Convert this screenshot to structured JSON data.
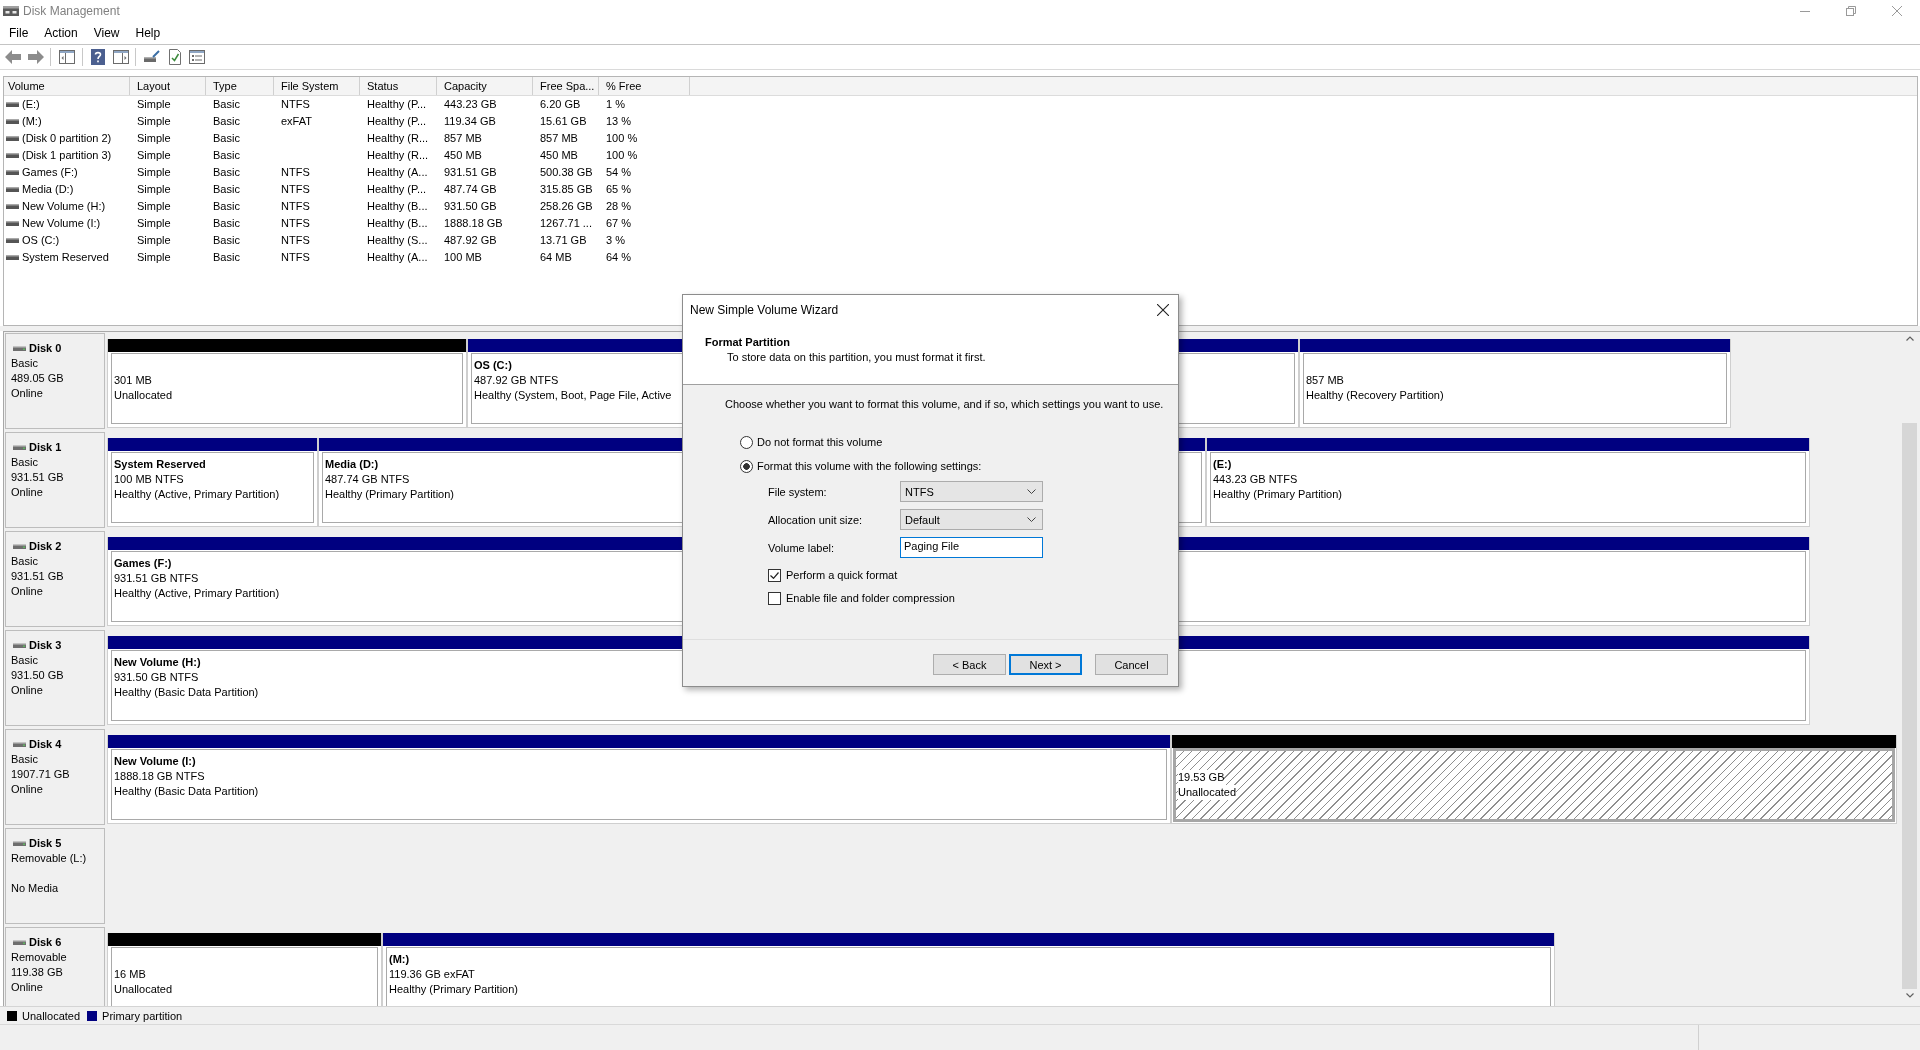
{
  "window": {
    "title": "Disk Management"
  },
  "menu": [
    "File",
    "Action",
    "View",
    "Help"
  ],
  "volume_list": {
    "columns": [
      "Volume",
      "Layout",
      "Type",
      "File System",
      "Status",
      "Capacity",
      "Free Spa...",
      "% Free"
    ],
    "rows": [
      {
        "volume": "(E:)",
        "layout": "Simple",
        "type": "Basic",
        "file_system": "NTFS",
        "status": "Healthy (P...",
        "capacity": "443.23 GB",
        "free_space": "6.20 GB",
        "percent_free": "1 %"
      },
      {
        "volume": "(M:)",
        "layout": "Simple",
        "type": "Basic",
        "file_system": "exFAT",
        "status": "Healthy (P...",
        "capacity": "119.34 GB",
        "free_space": "15.61 GB",
        "percent_free": "13 %"
      },
      {
        "volume": "(Disk 0 partition 2)",
        "layout": "Simple",
        "type": "Basic",
        "status": "Healthy (R...",
        "capacity": "857 MB",
        "free_space": "857 MB",
        "percent_free": "100 %"
      },
      {
        "volume": "(Disk 1 partition 3)",
        "layout": "Simple",
        "type": "Basic",
        "status": "Healthy (R...",
        "capacity": "450 MB",
        "free_space": "450 MB",
        "percent_free": "100 %"
      },
      {
        "volume": "Games (F:)",
        "layout": "Simple",
        "type": "Basic",
        "file_system": "NTFS",
        "status": "Healthy (A...",
        "capacity": "931.51 GB",
        "free_space": "500.38 GB",
        "percent_free": "54 %"
      },
      {
        "volume": "Media (D:)",
        "layout": "Simple",
        "type": "Basic",
        "file_system": "NTFS",
        "status": "Healthy (P...",
        "capacity": "487.74 GB",
        "free_space": "315.85 GB",
        "percent_free": "65 %"
      },
      {
        "volume": "New Volume (H:)",
        "layout": "Simple",
        "type": "Basic",
        "file_system": "NTFS",
        "status": "Healthy (B...",
        "capacity": "931.50 GB",
        "free_space": "258.26 GB",
        "percent_free": "28 %"
      },
      {
        "volume": "New Volume (I:)",
        "layout": "Simple",
        "type": "Basic",
        "file_system": "NTFS",
        "status": "Healthy (B...",
        "capacity": "1888.18 GB",
        "free_space": "1267.71 ...",
        "percent_free": "67 %"
      },
      {
        "volume": "OS (C:)",
        "layout": "Simple",
        "type": "Basic",
        "file_system": "NTFS",
        "status": "Healthy (S...",
        "capacity": "487.92 GB",
        "free_space": "13.71 GB",
        "percent_free": "3 %"
      },
      {
        "volume": "System Reserved",
        "layout": "Simple",
        "type": "Basic",
        "file_system": "NTFS",
        "status": "Healthy (A...",
        "capacity": "100 MB",
        "free_space": "64 MB",
        "percent_free": "64 %"
      }
    ]
  },
  "disks": [
    {
      "name": "Disk 0",
      "details": {
        "type": "Basic",
        "capacity": "489.05 GB",
        "status": "Online"
      },
      "partitions": [
        {
          "kind": "unallocated",
          "selected": false,
          "size": "301 MB",
          "status": "Unallocated"
        },
        {
          "kind": "primary",
          "selected": false,
          "name": "OS (C:)",
          "size": "487.92 GB NTFS",
          "status": "Healthy (System, Boot, Page File, Active"
        },
        {
          "kind": "primary",
          "selected": false,
          "size": "857 MB",
          "status": "Healthy (Recovery Partition)"
        }
      ]
    },
    {
      "name": "Disk 1",
      "details": {
        "type": "Basic",
        "capacity": "931.51 GB",
        "status": "Online"
      },
      "partitions": [
        {
          "kind": "primary",
          "selected": false,
          "name": "System Reserved",
          "size": "100 MB NTFS",
          "status": "Healthy (Active, Primary Partition)"
        },
        {
          "kind": "primary",
          "selected": false,
          "name": "Media (D:)",
          "size": "487.74 GB NTFS",
          "status": "Healthy (Primary Partition)"
        },
        {
          "kind": "primary",
          "selected": false,
          "name": "(E:)",
          "size": "443.23 GB NTFS",
          "status": "Healthy (Primary Partition)"
        }
      ]
    },
    {
      "name": "Disk 2",
      "details": {
        "type": "Basic",
        "capacity": "931.51 GB",
        "status": "Online"
      },
      "partitions": [
        {
          "kind": "primary",
          "selected": false,
          "name": "Games (F:)",
          "size": "931.51 GB NTFS",
          "status": "Healthy (Active, Primary Partition)"
        }
      ]
    },
    {
      "name": "Disk 3",
      "details": {
        "type": "Basic",
        "capacity": "931.50 GB",
        "status": "Online"
      },
      "partitions": [
        {
          "kind": "primary",
          "selected": false,
          "name": "New Volume (H:)",
          "size": "931.50 GB NTFS",
          "status": "Healthy (Basic Data Partition)"
        }
      ]
    },
    {
      "name": "Disk 4",
      "details": {
        "type": "Basic",
        "capacity": "1907.71 GB",
        "status": "Online"
      },
      "partitions": [
        {
          "kind": "primary",
          "selected": false,
          "name": "New Volume (I:)",
          "size": "1888.18 GB NTFS",
          "status": "Healthy (Basic Data Partition)"
        },
        {
          "kind": "unallocated",
          "selected": true,
          "size": "19.53 GB",
          "status": "Unallocated"
        }
      ]
    },
    {
      "name": "Disk 5",
      "details": {
        "type": "Removable (L:)",
        "status": "No Media"
      }
    },
    {
      "name": "Disk 6",
      "details": {
        "type": "Removable",
        "capacity": "119.38 GB",
        "status": "Online"
      },
      "partitions": [
        {
          "kind": "unallocated",
          "selected": false,
          "size": "16 MB",
          "status": "Unallocated"
        },
        {
          "kind": "primary",
          "selected": false,
          "name": "(M:)",
          "size": "119.36 GB exFAT",
          "status": "Healthy (Primary Partition)"
        }
      ]
    }
  ],
  "legend": [
    {
      "label": "Unallocated",
      "color": "#000000"
    },
    {
      "label": "Primary partition",
      "color": "#000080"
    }
  ],
  "dialog": {
    "title": "New Simple Volume Wizard",
    "heading": "Format Partition",
    "subheading": "To store data on this partition, you must format it first.",
    "instruction": "Choose whether you want to format this volume, and if so, which settings you want to use.",
    "options": [
      {
        "label": "Do not format this volume",
        "selected": false
      },
      {
        "label": "Format this volume with the following settings:",
        "selected": true
      }
    ],
    "settings": [
      {
        "kind": "dropdown",
        "label": "File system:",
        "value": "NTFS"
      },
      {
        "kind": "dropdown",
        "label": "Allocation unit size:",
        "value": "Default"
      },
      {
        "kind": "text",
        "label": "Volume label:",
        "value": "Paging File"
      }
    ],
    "checkboxes": [
      {
        "label": "Perform a quick format",
        "checked": true
      },
      {
        "label": "Enable file and folder compression",
        "checked": false
      }
    ],
    "buttons": [
      {
        "label": "< Back",
        "default": false
      },
      {
        "label": "Next >",
        "default": true
      },
      {
        "label": "Cancel",
        "default": false
      }
    ]
  }
}
